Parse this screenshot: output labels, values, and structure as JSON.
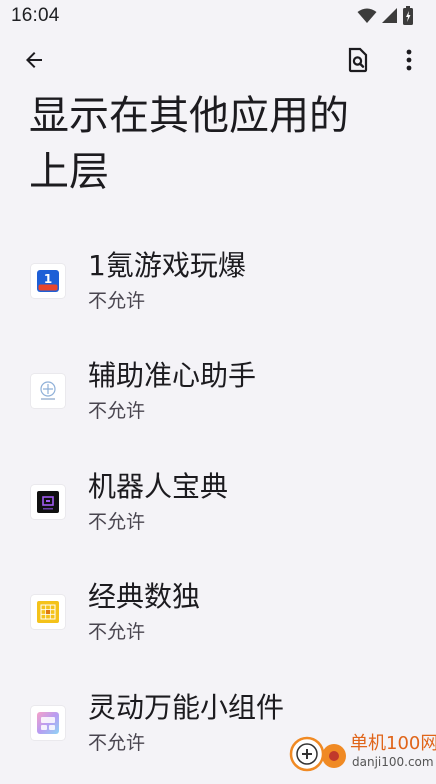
{
  "status_bar": {
    "time": "16:04",
    "icons": [
      "wifi-icon",
      "signal-icon",
      "battery-icon"
    ]
  },
  "toolbar": {
    "back_icon": "arrow-back-icon",
    "search_icon": "search-settings-icon",
    "more_icon": "more-vert-icon"
  },
  "page": {
    "title_line1": "显示在其他应用的",
    "title_line2": "上层"
  },
  "apps": [
    {
      "name": "1氪游戏玩爆",
      "status": "不允许",
      "icon": "app-1ke-icon"
    },
    {
      "name": "辅助准心助手",
      "status": "不允许",
      "icon": "app-crosshair-icon"
    },
    {
      "name": "机器人宝典",
      "status": "不允许",
      "icon": "app-robot-icon"
    },
    {
      "name": "经典数独",
      "status": "不允许",
      "icon": "app-sudoku-icon"
    },
    {
      "name": "灵动万能小组件",
      "status": "不允许",
      "icon": "app-widget-icon"
    }
  ],
  "watermark": {
    "text": "单机100网",
    "subtext": "danji100.com"
  },
  "colors": {
    "background": "#f4f3f7",
    "text_primary": "#1c1b1f",
    "text_secondary": "#49454f"
  }
}
